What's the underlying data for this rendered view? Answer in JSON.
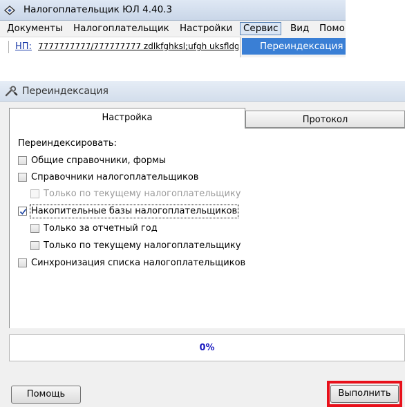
{
  "app": {
    "title": "Налогоплательщик ЮЛ 4.40.3",
    "menu": [
      "Документы",
      "Налогоплательщик",
      "Настройки",
      "Сервис",
      "Вид",
      "Помо"
    ],
    "active_menu": "Сервис",
    "address": {
      "np_label": "НП:",
      "value": "7777777777/777777777 zdlkfghksl;ufgh uksfldg"
    },
    "dropdown": {
      "item": "Переиндексация"
    }
  },
  "dialog": {
    "title": "Переиндексация",
    "tabs": {
      "settings": "Настройка",
      "protocol": "Протокол"
    },
    "reindex_label": "Переиндексировать:",
    "options": [
      {
        "label": "Общие справочники, формы",
        "checked": false,
        "enabled": true
      },
      {
        "label": "Справочники налогоплательщиков",
        "checked": false,
        "enabled": true
      },
      {
        "label": "Только по текущему налогоплательщику",
        "checked": false,
        "enabled": false
      },
      {
        "label": "Накопительные базы налогоплательщиков",
        "checked": true,
        "enabled": true
      },
      {
        "label": "Только за отчетный год",
        "checked": false,
        "enabled": true
      },
      {
        "label": "Только по текущему налогоплательщику",
        "checked": false,
        "enabled": true
      },
      {
        "label": "Синхронизация списка налогоплательщиков",
        "checked": false,
        "enabled": true
      }
    ],
    "progress": {
      "text": "0%",
      "value": 0
    },
    "buttons": {
      "help": "Помощь",
      "run": "Выполнить"
    }
  },
  "colors": {
    "menu_highlight": "#3a7fd5",
    "progress_text": "#1c1cc0",
    "run_button_frame": "#e8101a"
  }
}
